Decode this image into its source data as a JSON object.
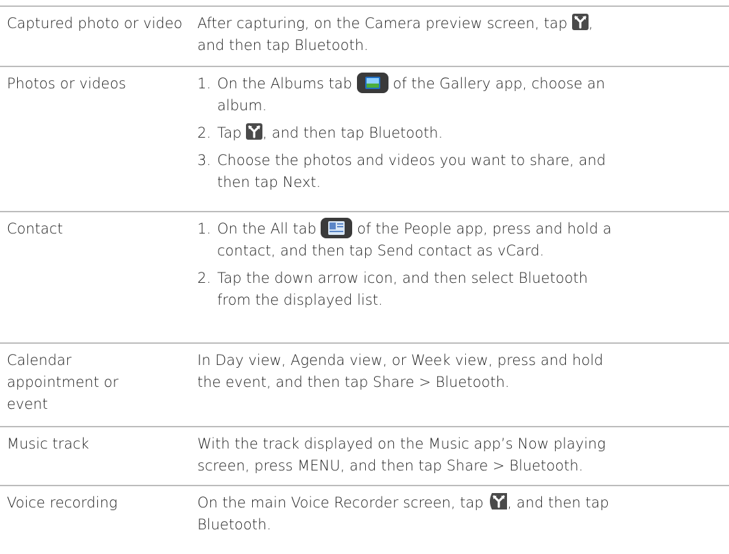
{
  "rows": [
    {
      "label": "Captured photo or video",
      "body": {
        "t1": "After capturing, on the Camera preview screen, tap ",
        "t2": ",",
        "t3": "and then tap Bluetooth."
      }
    },
    {
      "label": "Photos or videos",
      "steps": [
        {
          "num": "1.",
          "t1": "On the Albums tab ",
          "t2": " of the Gallery app, choose an",
          "t3": "album."
        },
        {
          "num": "2.",
          "t1": "Tap ",
          "t2": ", and then tap Bluetooth."
        },
        {
          "num": "3.",
          "t1": "Choose the photos and videos you want to share, and",
          "t2": "then tap Next."
        }
      ]
    },
    {
      "label": "Contact",
      "steps": [
        {
          "num": "1.",
          "t1": "On the All tab ",
          "t2": " of the People app, press and hold a",
          "t3": "contact, and then tap Send contact as vCard."
        },
        {
          "num": "2.",
          "t1": "Tap the down arrow icon, and then select Bluetooth",
          "t2": "from the displayed list."
        }
      ]
    },
    {
      "label_lines": [
        "Calendar",
        "appointment or",
        "event"
      ],
      "body": {
        "l1": "In Day view, Agenda view, or Week view, press and hold",
        "l2": "the event, and then tap Share > Bluetooth."
      }
    },
    {
      "label": "Music track",
      "body": {
        "l1": "With the track displayed on the Music app’s Now playing",
        "l2": "screen, press MENU, and then tap Share > Bluetooth."
      }
    },
    {
      "label": "Voice recording",
      "body": {
        "t1": "On the main Voice Recorder screen, tap ",
        "t2": ", and then tap",
        "t3": "Bluetooth."
      }
    }
  ],
  "icons": {
    "share": "share-icon",
    "albums_tab": "albums-tab-icon",
    "people_all_tab": "people-all-tab-icon"
  },
  "colors": {
    "text": "#222222",
    "divider": "#bcbcbc"
  }
}
